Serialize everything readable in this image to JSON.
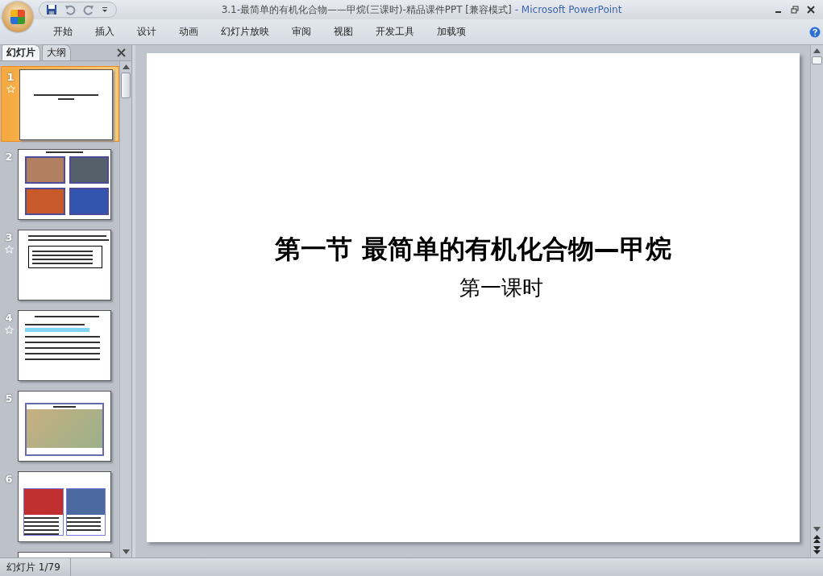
{
  "window": {
    "title": "3.1-最简单的有机化合物——甲烷(三课时)-精品课件PPT [兼容模式]",
    "app_name": "- Microsoft PowerPoint"
  },
  "ribbon_tabs": [
    {
      "label": "开始",
      "selected": false
    },
    {
      "label": "插入",
      "selected": false
    },
    {
      "label": "设计",
      "selected": false
    },
    {
      "label": "动画",
      "selected": false
    },
    {
      "label": "幻灯片放映",
      "selected": false
    },
    {
      "label": "审阅",
      "selected": false
    },
    {
      "label": "视图",
      "selected": false
    },
    {
      "label": "开发工具",
      "selected": false
    },
    {
      "label": "加载项",
      "selected": false
    }
  ],
  "panel_tabs": [
    {
      "label": "幻灯片",
      "selected": true
    },
    {
      "label": "大纲",
      "selected": false
    }
  ],
  "slides": [
    {
      "number": "1",
      "animated": true,
      "selected": true,
      "kind": "title"
    },
    {
      "number": "2",
      "animated": false,
      "selected": false,
      "kind": "photo-grid"
    },
    {
      "number": "3",
      "animated": true,
      "selected": false,
      "kind": "text-table"
    },
    {
      "number": "4",
      "animated": true,
      "selected": false,
      "kind": "text-list"
    },
    {
      "number": "5",
      "animated": false,
      "selected": false,
      "kind": "map"
    },
    {
      "number": "6",
      "animated": false,
      "selected": false,
      "kind": "photo-text"
    }
  ],
  "slide": {
    "title": "第一节 最简单的有机化合物—甲烷",
    "subtitle": "第一课时"
  },
  "status_bar": {
    "slide_indicator": "幻灯片 1/79"
  }
}
